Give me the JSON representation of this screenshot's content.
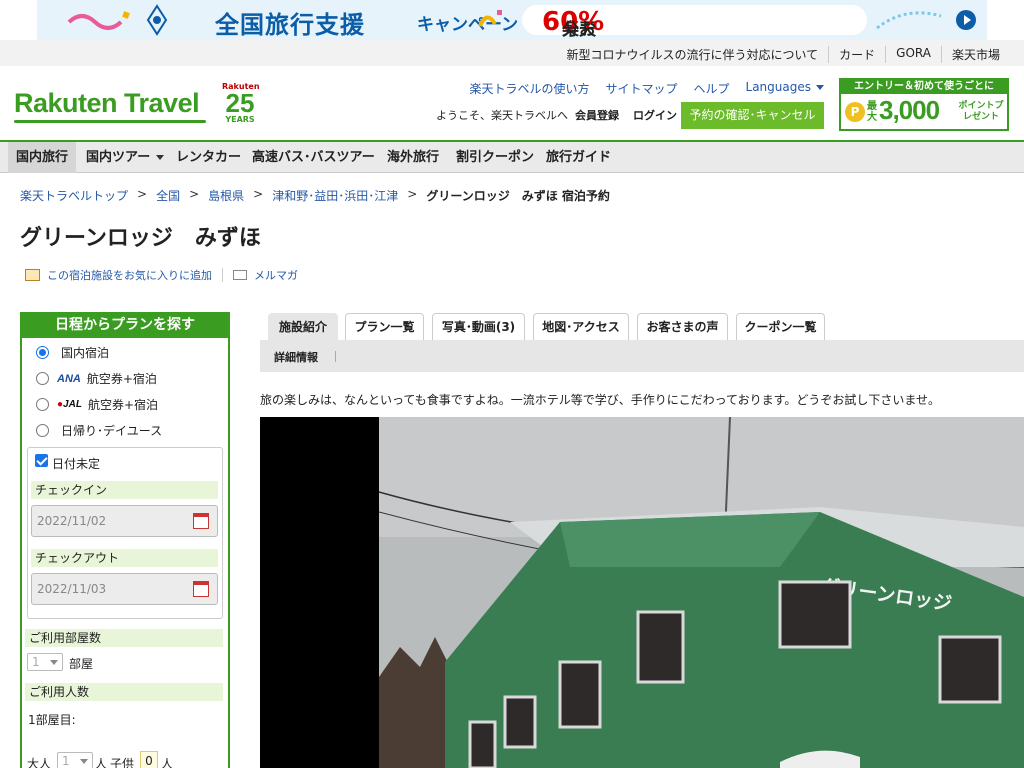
{
  "banner": {
    "title": "全国旅行支援",
    "subtitle": "キャンペーン",
    "pill_pre": "楽天トラベルなら最大",
    "pill_big": "60%",
    "pill_post": "分お得!"
  },
  "util_links": [
    "新型コロナウイルスの流行に伴う対応について",
    "カード",
    "GORA",
    "楽天市場"
  ],
  "header": {
    "logo": "Rakuten Travel",
    "anniv_brand": "Rakuten",
    "anniv_num": "25",
    "anniv_years": "YEARS",
    "links": [
      "楽天トラベルの使い方",
      "サイトマップ",
      "ヘルプ"
    ],
    "languages": "Languages",
    "welcome": "ようこそ、楽天トラベルへ",
    "member": "会員登録",
    "login": "ログイン",
    "reserve": "予約の確認･キャンセル",
    "promo_top": "エントリー＆初めて使うごとに",
    "promo_small": "最大",
    "promo_big": "3,000",
    "promo_pt": "ポイントプレゼント",
    "promo_coin": "P"
  },
  "nav": [
    {
      "label": "国内旅行",
      "active": true
    },
    {
      "label": "国内ツアー",
      "caret": true
    },
    {
      "label": "レンタカー"
    },
    {
      "label": "高速バス･バスツアー"
    },
    {
      "label": "海外旅行"
    },
    {
      "label": "割引クーポン"
    },
    {
      "label": "旅行ガイド"
    }
  ],
  "breadcrumb": {
    "links": [
      "楽天トラベルトップ",
      "全国",
      "島根県",
      "津和野･益田･浜田･江津"
    ],
    "current": "グリーンロッジ　みずほ 宿泊予約"
  },
  "page_title": "グリーンロッジ　みずほ",
  "fav": {
    "add": "この宿泊施設をお気に入りに追加",
    "mail": "メルマガ"
  },
  "search": {
    "heading": "日程からプランを探す",
    "options": {
      "domestic": "国内宿泊",
      "ana_logo": "ANA",
      "ana": "航空券+宿泊",
      "jal_logo": "JAL",
      "jal": "航空券+宿泊",
      "day": "日帰り･デイユース"
    },
    "undecided": "日付未定",
    "checkin_label": "チェックイン",
    "checkin": "2022/11/02",
    "checkout_label": "チェックアウト",
    "checkout": "2022/11/03",
    "rooms_label": "ご利用部屋数",
    "rooms": "1",
    "rooms_unit": "部屋",
    "guests_label": "ご利用人数",
    "room1": "1部屋目:",
    "adult_label": "大人",
    "adult": "1",
    "person_unit": "人",
    "child_label": "子供",
    "child": "0"
  },
  "tabs": [
    "施設紹介",
    "プラン一覧",
    "写真･動画(3)",
    "地図･アクセス",
    "お客さまの声",
    "クーポン一覧"
  ],
  "subtab": "詳細情報",
  "intro": "旅の楽しみは、なんといっても食事ですよね。一流ホテル等で学び、手作りにこだわっております。どうぞお試し下さいませ。",
  "photo_sign": "グリーンロッジ",
  "colors": {
    "brand": "#3a9c20",
    "link": "#2458a8",
    "reserve": "#6cbb2a"
  }
}
